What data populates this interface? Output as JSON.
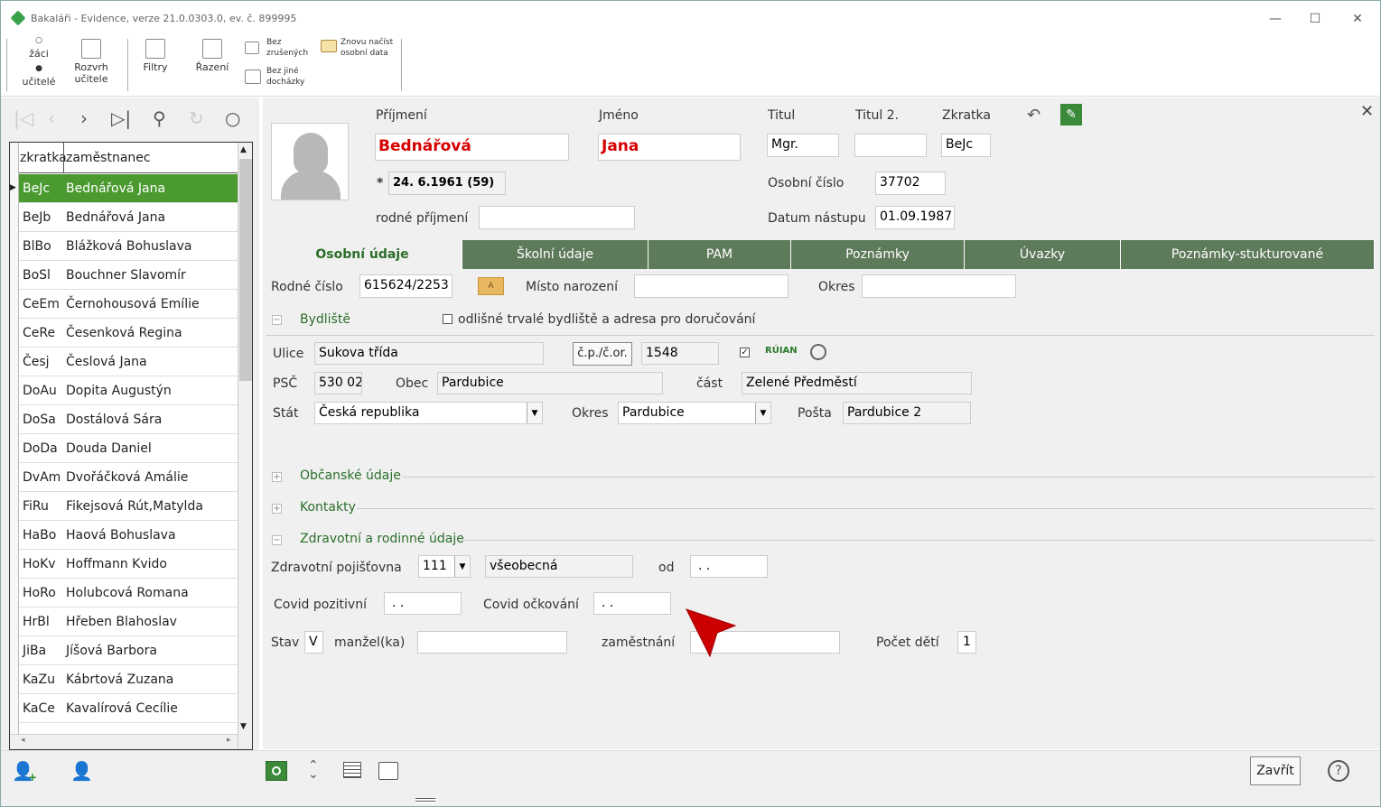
{
  "window": {
    "title": "Bakaláři - Evidence, verze 21.0.0303.0, ev. č. 899995",
    "minimize": "—",
    "maximize": "☐",
    "close": "✕"
  },
  "ribbon": {
    "radio_zaci": "žáci",
    "radio_ucitele": "učitelé",
    "rozvrh_line1": "Rozvrh",
    "rozvrh_line2": "učitele",
    "filtry": "Filtry",
    "razeni": "Řazení",
    "bez_zrusenych_1": "Bez",
    "bez_zrusenych_2": "zrušených",
    "bez_jine_1": "Bez jiné",
    "bez_jine_2": "docházky",
    "znovu_1": "Znovu načíst",
    "znovu_2": "osobní data"
  },
  "grid": {
    "col_zkratka": "zkratka",
    "col_zamestnanec": "zaměstnanec",
    "rows": [
      {
        "zk": "BeJc",
        "name": "Bednářová Jana"
      },
      {
        "zk": "BeJb",
        "name": "Bednářová Jana"
      },
      {
        "zk": "BlBo",
        "name": "Blážková Bohuslava"
      },
      {
        "zk": "BoSl",
        "name": "Bouchner Slavomír"
      },
      {
        "zk": "CeEm",
        "name": "Černohousová Emílie"
      },
      {
        "zk": "CeRe",
        "name": "Česenková Regina"
      },
      {
        "zk": "Česj",
        "name": "Česlová Jana"
      },
      {
        "zk": "DoAu",
        "name": "Dopita Augustýn"
      },
      {
        "zk": "DoSa",
        "name": "Dostálová Sára"
      },
      {
        "zk": "DoDa",
        "name": "Douda Daniel"
      },
      {
        "zk": "DvAm",
        "name": "Dvořáčková Amálie"
      },
      {
        "zk": "FiRu",
        "name": "Fikejsová Rút,Matylda"
      },
      {
        "zk": "HaBo",
        "name": "Haová Bohuslava"
      },
      {
        "zk": "HoKv",
        "name": "Hoffmann Kvido"
      },
      {
        "zk": "HoRo",
        "name": "Holubcová Romana"
      },
      {
        "zk": "HrBl",
        "name": "Hřeben Blahoslav"
      },
      {
        "zk": "JiBa",
        "name": "Jíšová Barbora"
      },
      {
        "zk": "KaZu",
        "name": "Kábrtová Zuzana"
      },
      {
        "zk": "KaCe",
        "name": "Kavalírová Cecílie"
      }
    ]
  },
  "person": {
    "prijmeni_label": "Příjmení",
    "jmeno_label": "Jméno",
    "titul_label": "Titul",
    "titul2_label": "Titul 2.",
    "zkratka_label": "Zkratka",
    "prijmeni": "Bednářová",
    "jmeno": "Jana",
    "titul": "Mgr.",
    "titul2": "",
    "zkratka": "BeJc",
    "birth_star": "*",
    "birth": "24. 6.1961 (59)",
    "osobni_cislo_label": "Osobní číslo",
    "osobni_cislo": "37702",
    "rodne_prijmeni_label": "rodné příjmení",
    "rodne_prijmeni": "",
    "datum_nastupu_label": "Datum nástupu",
    "datum_nastupu": "01.09.1987"
  },
  "tabs": [
    {
      "label": "Osobní údaje"
    },
    {
      "label": "Školní údaje"
    },
    {
      "label": "PAM"
    },
    {
      "label": "Poznámky"
    },
    {
      "label": "Úvazky"
    },
    {
      "label": "Poznámky-stukturované"
    }
  ],
  "osobni": {
    "rodne_cislo_label": "Rodné číslo",
    "rodne_cislo": "615624/2253",
    "misto_narozeni_label": "Místo narození",
    "misto_narozeni": "",
    "okres_label": "Okres",
    "okres": "",
    "bydliste_title": "Bydliště",
    "odlisne_label": "odlišné trvalé bydliště a adresa pro doručování",
    "ulice_label": "Ulice",
    "ulice": "Sukova třída",
    "cp_button": "č.p./č.or.",
    "cp": "1548",
    "ruian": "RÚIAN",
    "psc_label": "PSČ",
    "psc": "530 02",
    "obec_label": "Obec",
    "obec": "Pardubice",
    "cast_label": "část",
    "cast": "Zelené Předměstí",
    "stat_label": "Stát",
    "stat": "Česká republika",
    "okres2_label": "Okres",
    "okres2": "Pardubice",
    "posta_label": "Pošta",
    "posta": "Pardubice 2",
    "obcanske_title": "Občanské údaje",
    "kontakty_title": "Kontakty",
    "zdravotni_title": "Zdravotní a rodinné údaje",
    "pojistovna_label": "Zdravotní pojišťovna",
    "pojistovna_kod": "111",
    "pojistovna_nazev": "všeobecná",
    "od_label": "od",
    "od": ". .",
    "covid_poz_label": "Covid pozitivní",
    "covid_poz": ". .",
    "covid_ock_label": "Covid očkování",
    "covid_ock": ". .",
    "stav_label": "Stav",
    "stav": "V",
    "manzel_label": "manžel(ka)",
    "manzel": "",
    "zamestnani_label": "zaměstnání",
    "zamestnani": "",
    "pocet_deti_label": "Počet dětí",
    "pocet_deti": "1"
  },
  "bottom": {
    "zavrit": "Zavřít",
    "help": "?"
  },
  "colors": {
    "accent_green": "#4a9a30",
    "tab_green": "#5d7a5a",
    "name_red": "#d60000",
    "arrow_red": "#cc0000"
  }
}
